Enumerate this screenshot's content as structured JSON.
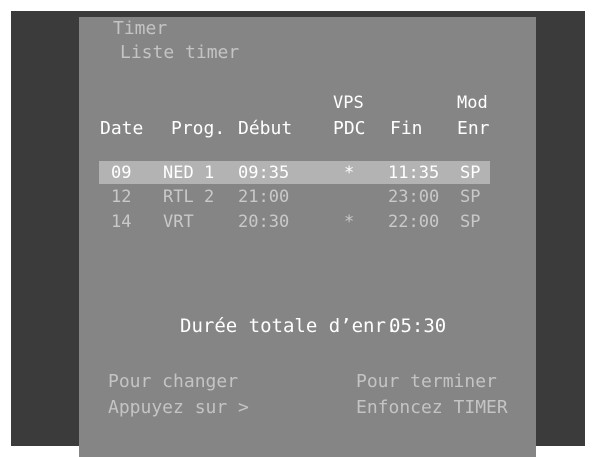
{
  "header": {
    "title": "Timer",
    "subtitle": "Liste timer"
  },
  "table": {
    "columns": {
      "date": "Date",
      "prog": "Prog.",
      "debut": "Début",
      "vps_top": "VPS",
      "vps_bottom": "PDC",
      "fin": "Fin",
      "mod_top": "Mod",
      "mod_bottom": "Enr"
    },
    "rows": [
      {
        "date": "09",
        "prog": "NED 1",
        "debut": "09:35",
        "vps": "*",
        "fin": "11:35",
        "mod": "SP",
        "selected": true
      },
      {
        "date": "12",
        "prog": "RTL 2",
        "debut": "21:00",
        "vps": "",
        "fin": "23:00",
        "mod": "SP",
        "selected": false
      },
      {
        "date": "14",
        "prog": "VRT",
        "debut": "20:30",
        "vps": "*",
        "fin": "22:00",
        "mod": "SP",
        "selected": false
      }
    ]
  },
  "total": {
    "label": "Durée totale d’enr.",
    "value": "05:30"
  },
  "footer": {
    "left_line1": "Pour changer",
    "left_line2": "Appuyez sur >",
    "right_line1": "Pour terminer",
    "right_line2": "Enfoncez TIMER"
  },
  "colors": {
    "screen_background": "#3b3b3b",
    "panel_background": "#858585",
    "selection_bar": "#b3b3b3"
  }
}
